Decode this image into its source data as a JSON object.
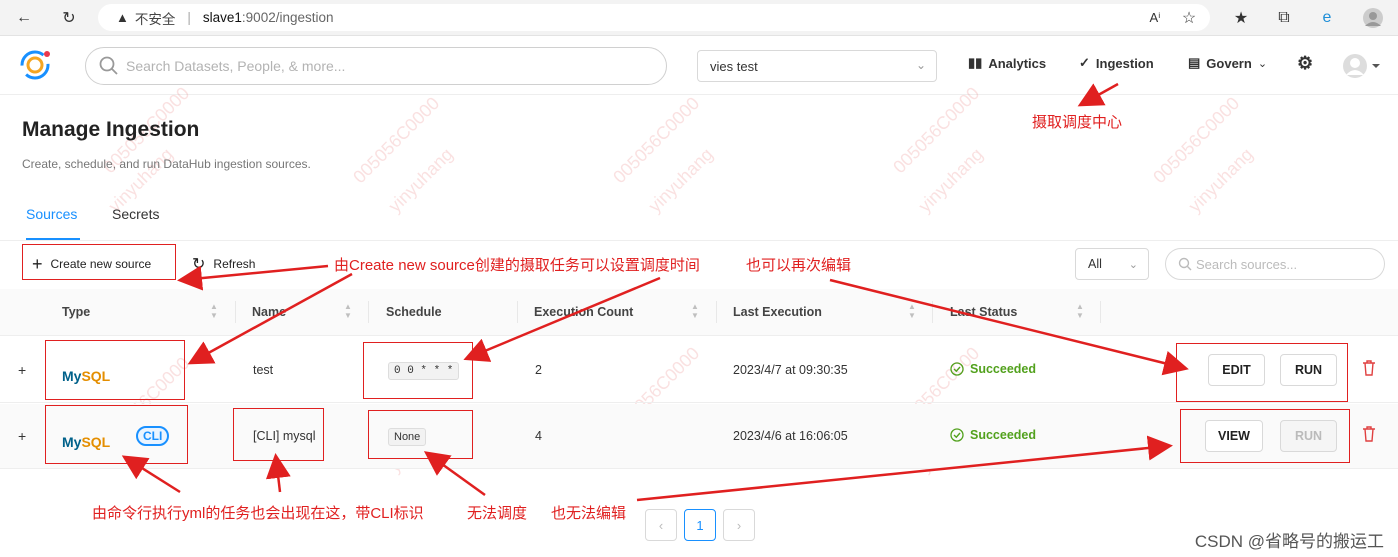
{
  "browser": {
    "security_label": "不安全",
    "url_host": "slave1",
    "url_path": ":9002/ingestion"
  },
  "header": {
    "search_placeholder": "Search Datasets, People, & more...",
    "view_select": "vies test",
    "nav": {
      "analytics": "Analytics",
      "ingestion": "Ingestion",
      "govern": "Govern"
    }
  },
  "page": {
    "title": "Manage Ingestion",
    "subtitle": "Create, schedule, and run DataHub ingestion sources.",
    "tabs": [
      "Sources",
      "Secrets"
    ],
    "create_label": "Create new source",
    "refresh_label": "Refresh",
    "filter_value": "All",
    "search_placeholder": "Search sources..."
  },
  "table": {
    "columns": [
      "Type",
      "Name",
      "Schedule",
      "Execution Count",
      "Last Execution",
      "Last Status"
    ],
    "rows": [
      {
        "type": "MySQL",
        "cli": "",
        "name": "test",
        "schedule": "0 0 * * *",
        "count": "2",
        "last": "2023/4/7 at 09:30:35",
        "status": "Succeeded",
        "primary_action": "EDIT",
        "run": "RUN"
      },
      {
        "type": "MySQL",
        "cli": "CLI",
        "name": "[CLI] mysql",
        "schedule": "None",
        "count": "4",
        "last": "2023/4/6 at 16:06:05",
        "status": "Succeeded",
        "primary_action": "VIEW",
        "run": "RUN"
      }
    ]
  },
  "pagination": {
    "current": "1"
  },
  "annotations": {
    "ingestion_center": "摄取调度中心",
    "create_note": "由Create new source创建的摄取任务可以设置调度时间",
    "edit_note": "也可以再次编辑",
    "cli_note": "由命令行执行yml的任务也会出现在这，带CLI标识",
    "no_schedule": "无法调度",
    "no_edit": "也无法编辑"
  },
  "watermark": {
    "repeat_id": "005056C0000",
    "repeat_user": "yinyuhang",
    "corner": "CSDN @省略号的搬运工"
  },
  "colors": {
    "accent": "#1890ff",
    "annotation": "#e02020",
    "success": "#52a11d"
  }
}
